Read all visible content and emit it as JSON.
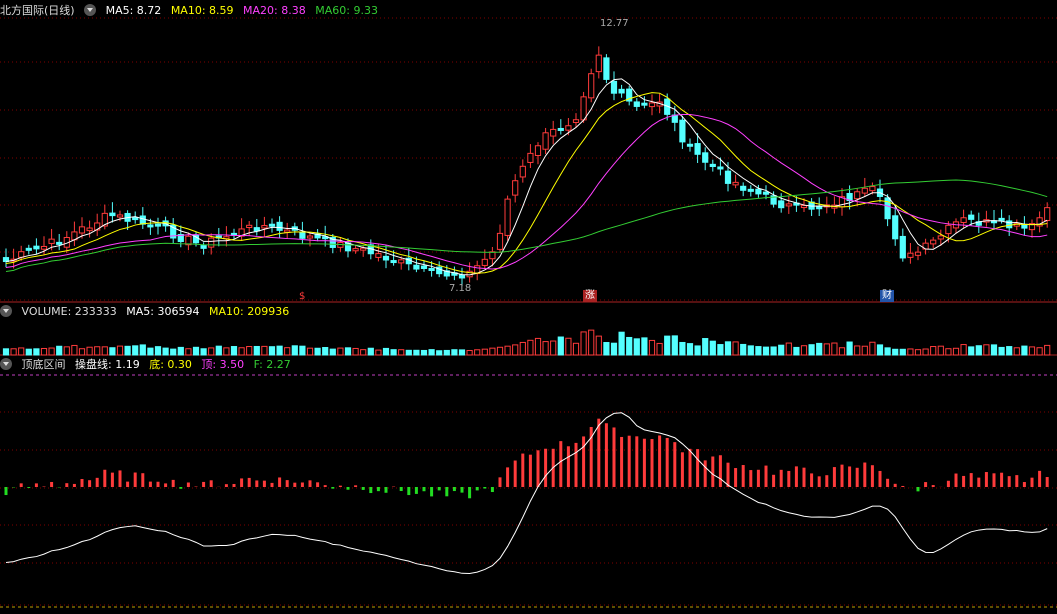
{
  "price_panel": {
    "title": "北方国际(日线)",
    "ma5": "MA5: 8.72",
    "ma10": "MA10: 8.59",
    "ma20": "MA20: 8.38",
    "ma60": "MA60: 9.33",
    "high_label": "12.77",
    "low_label": "7.18",
    "markers": [
      "$",
      "涨",
      "财"
    ]
  },
  "volume_panel": {
    "vol": "VOLUME: 233333",
    "ma5": "MA5: 306594",
    "ma10": "MA10: 209936"
  },
  "indicator_panel": {
    "title": "顶底区间",
    "line": "操盘线: 1.19",
    "bottom": "底: 0.30",
    "top": "顶: 3.50",
    "f": "F: 2.27"
  },
  "colors": {
    "up": "#ff3b3b",
    "down": "#54ffff",
    "ma5": "#ffffff",
    "ma10": "#ffff00",
    "ma20": "#ff40ff",
    "ma60": "#33cc33",
    "grid": "#800000"
  }
}
